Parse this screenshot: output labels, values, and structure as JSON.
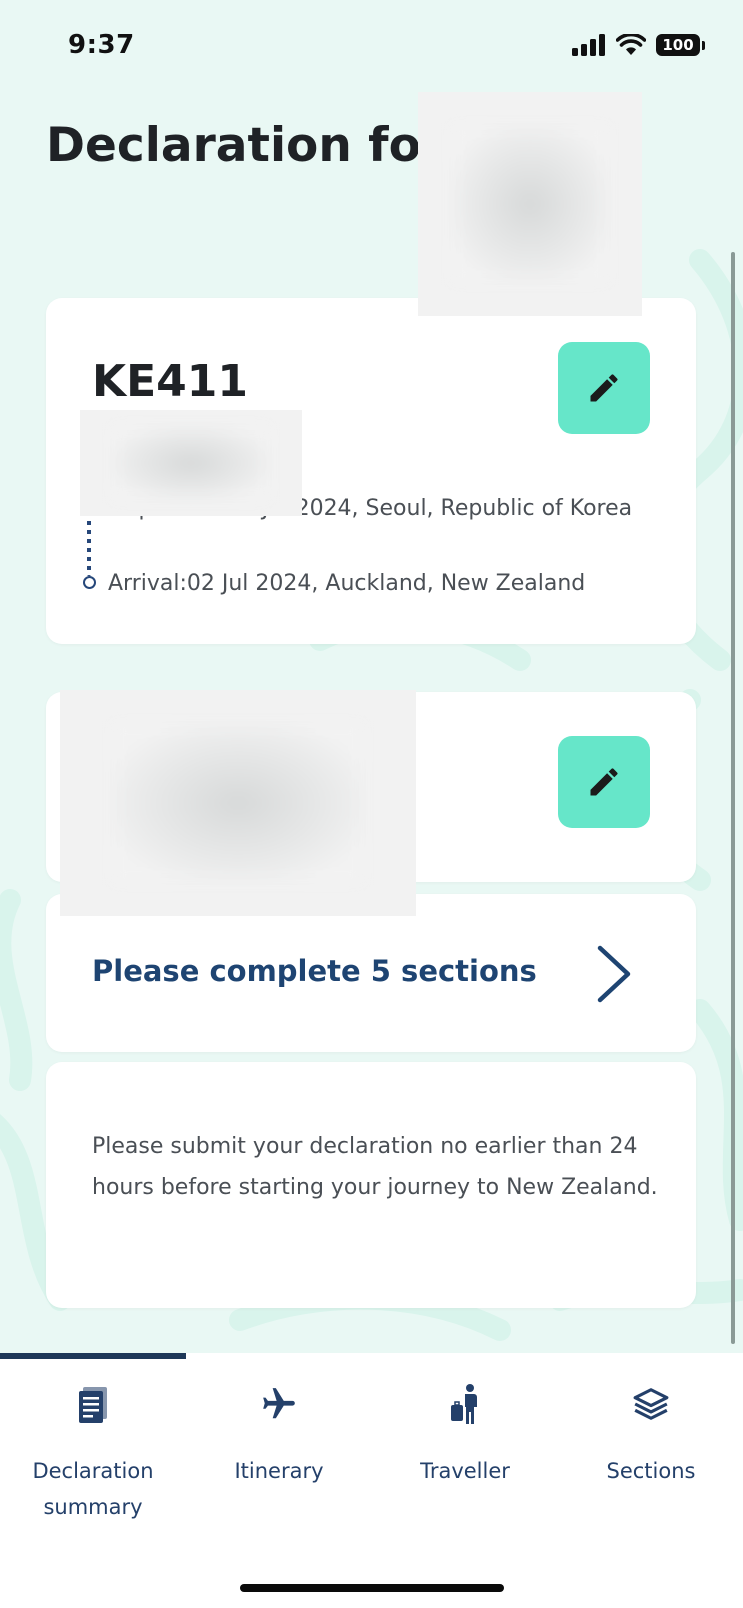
{
  "status_bar": {
    "time": "9:37",
    "battery_level": "100"
  },
  "page": {
    "title": "Declaration for"
  },
  "flight": {
    "number": "KE411",
    "departure": "Departure:01 Jul 2024, Seoul, Republic of Korea",
    "departure_visible": "024, Seoul, Republic of Korea",
    "arrival": "Arrival:02 Jul 2024, Auckland, New Zealand"
  },
  "sections": {
    "prompt": "Please complete 5 sections"
  },
  "info": {
    "message": "Please submit your declaration no earlier than 24 hours before starting your journey to New Zealand."
  },
  "nav": {
    "items": [
      {
        "label": "Declaration summary",
        "icon": "document-icon",
        "active": true
      },
      {
        "label": "Itinerary",
        "icon": "airplane-icon",
        "active": false
      },
      {
        "label": "Traveller",
        "icon": "traveller-luggage-icon",
        "active": false
      },
      {
        "label": "Sections",
        "icon": "layers-icon",
        "active": false
      }
    ]
  },
  "colors": {
    "background": "#e9f8f4",
    "accent": "#66e6c9",
    "navy": "#1e4472",
    "nav_indicator": "#1e3858"
  }
}
